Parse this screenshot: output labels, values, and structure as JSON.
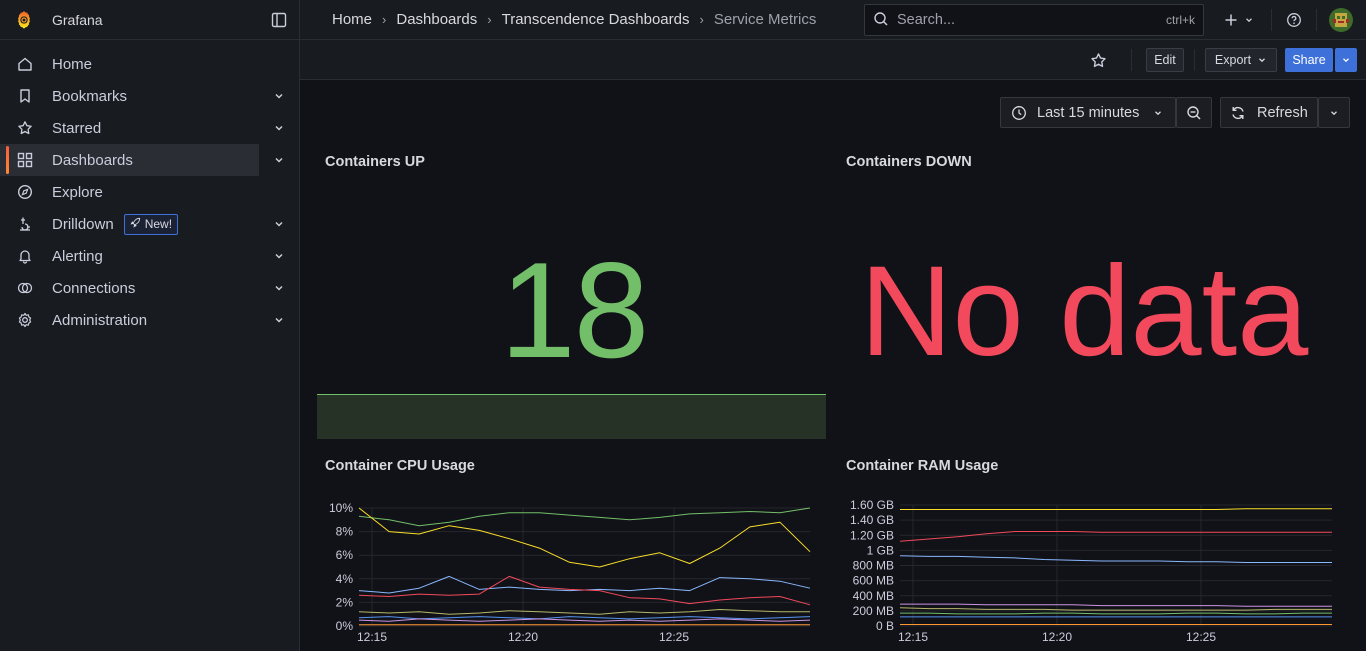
{
  "app": {
    "name": "Grafana"
  },
  "sidebar": {
    "items": [
      {
        "label": "Home",
        "icon": "home-icon",
        "expandable": false
      },
      {
        "label": "Bookmarks",
        "icon": "bookmark-icon",
        "expandable": true
      },
      {
        "label": "Starred",
        "icon": "star-icon",
        "expandable": true
      },
      {
        "label": "Dashboards",
        "icon": "apps-icon",
        "expandable": true,
        "active": true
      },
      {
        "label": "Explore",
        "icon": "compass-icon",
        "expandable": false
      },
      {
        "label": "Drilldown",
        "icon": "drilldown-icon",
        "expandable": true,
        "badge": "New!"
      },
      {
        "label": "Alerting",
        "icon": "bell-icon",
        "expandable": true
      },
      {
        "label": "Connections",
        "icon": "connections-icon",
        "expandable": true
      },
      {
        "label": "Administration",
        "icon": "cog-icon",
        "expandable": true
      }
    ]
  },
  "breadcrumbs": [
    "Home",
    "Dashboards",
    "Transcendence Dashboards",
    "Service Metrics"
  ],
  "search": {
    "placeholder": "Search...",
    "shortcut": "ctrl+k"
  },
  "toolbar": {
    "edit": "Edit",
    "export": "Export",
    "share": "Share"
  },
  "time": {
    "range": "Last 15 minutes",
    "refresh": "Refresh"
  },
  "colors": {
    "accent": "#3d71d9",
    "green": "#73bf69",
    "red": "#f2495c",
    "yellow": "#fade2a",
    "blue": "#8ab8ff"
  },
  "panels": {
    "up": {
      "title": "Containers UP",
      "value": "18"
    },
    "down": {
      "title": "Containers DOWN",
      "value": "No data"
    },
    "cpu": {
      "title": "Container CPU Usage"
    },
    "ram": {
      "title": "Container RAM Usage"
    }
  },
  "chart_data": [
    {
      "type": "line",
      "title": "Container CPU Usage",
      "x_ticks": [
        "12:15",
        "12:20",
        "12:25"
      ],
      "y_ticks": [
        "0%",
        "2%",
        "4%",
        "6%",
        "8%",
        "10%"
      ],
      "ylim": [
        0,
        10
      ],
      "x": [
        0,
        1,
        2,
        3,
        4,
        5,
        6,
        7,
        8,
        9,
        10,
        11,
        12,
        13,
        14,
        15
      ],
      "series": [
        {
          "color": "#73bf69",
          "values": [
            9.3,
            9.0,
            8.5,
            8.8,
            9.3,
            9.6,
            9.6,
            9.4,
            9.2,
            9.0,
            9.2,
            9.5,
            9.6,
            9.7,
            9.6,
            10.0
          ]
        },
        {
          "color": "#fade2a",
          "values": [
            10.0,
            8.0,
            7.8,
            8.5,
            8.1,
            7.4,
            6.6,
            5.4,
            5.0,
            5.7,
            6.2,
            5.3,
            6.6,
            8.4,
            8.8,
            6.3
          ]
        },
        {
          "color": "#8ab8ff",
          "values": [
            3.0,
            2.8,
            3.2,
            4.2,
            3.1,
            3.3,
            3.1,
            3.0,
            3.1,
            3.0,
            3.2,
            3.0,
            4.1,
            4.0,
            3.8,
            3.2
          ]
        },
        {
          "color": "#f2495c",
          "values": [
            2.6,
            2.5,
            2.7,
            2.6,
            2.7,
            4.2,
            3.3,
            3.1,
            3.0,
            2.4,
            2.3,
            1.9,
            2.2,
            2.4,
            2.5,
            1.8
          ]
        },
        {
          "color": "#b7b76b",
          "values": [
            1.2,
            1.1,
            1.2,
            1.0,
            1.1,
            1.3,
            1.2,
            1.1,
            1.0,
            1.2,
            1.1,
            1.2,
            1.4,
            1.3,
            1.2,
            1.2
          ]
        },
        {
          "color": "#5794f2",
          "values": [
            0.7,
            0.8,
            0.6,
            0.7,
            0.8,
            0.7,
            0.6,
            0.8,
            0.7,
            0.6,
            0.7,
            0.8,
            0.7,
            0.6,
            0.7,
            0.8
          ]
        },
        {
          "color": "#ca95e5",
          "values": [
            0.5,
            0.4,
            0.6,
            0.5,
            0.4,
            0.5,
            0.6,
            0.5,
            0.4,
            0.5,
            0.4,
            0.5,
            0.6,
            0.5,
            0.4,
            0.5
          ]
        },
        {
          "color": "#ff9830",
          "values": [
            0.1,
            0.1,
            0.1,
            0.1,
            0.1,
            0.1,
            0.1,
            0.1,
            0.1,
            0.1,
            0.1,
            0.1,
            0.1,
            0.1,
            0.1,
            0.1
          ]
        }
      ]
    },
    {
      "type": "line",
      "title": "Container RAM Usage",
      "x_ticks": [
        "12:15",
        "12:20",
        "12:25"
      ],
      "y_ticks": [
        "0 B",
        "200 MB",
        "400 MB",
        "600 MB",
        "800 MB",
        "1 GB",
        "1.20 GB",
        "1.40 GB",
        "1.60 GB"
      ],
      "ylim": [
        0,
        1.6
      ],
      "y_unit": "GB",
      "x": [
        0,
        1,
        2,
        3,
        4,
        5,
        6,
        7,
        8,
        9,
        10,
        11,
        12,
        13,
        14,
        15
      ],
      "series": [
        {
          "color": "#fade2a",
          "values": [
            1.54,
            1.54,
            1.54,
            1.54,
            1.54,
            1.54,
            1.54,
            1.54,
            1.54,
            1.54,
            1.54,
            1.54,
            1.55,
            1.55,
            1.55,
            1.55
          ]
        },
        {
          "color": "#f2495c",
          "values": [
            1.12,
            1.15,
            1.18,
            1.22,
            1.25,
            1.25,
            1.25,
            1.24,
            1.24,
            1.24,
            1.24,
            1.24,
            1.24,
            1.24,
            1.24,
            1.24
          ]
        },
        {
          "color": "#8ab8ff",
          "values": [
            0.93,
            0.92,
            0.92,
            0.91,
            0.9,
            0.88,
            0.87,
            0.86,
            0.86,
            0.86,
            0.85,
            0.85,
            0.84,
            0.84,
            0.84,
            0.84
          ]
        },
        {
          "color": "#ca95e5",
          "values": [
            0.29,
            0.29,
            0.29,
            0.28,
            0.28,
            0.28,
            0.28,
            0.27,
            0.27,
            0.27,
            0.27,
            0.27,
            0.26,
            0.26,
            0.26,
            0.26
          ]
        },
        {
          "color": "#b7b76b",
          "values": [
            0.24,
            0.23,
            0.23,
            0.22,
            0.22,
            0.22,
            0.21,
            0.21,
            0.21,
            0.21,
            0.21,
            0.21,
            0.21,
            0.22,
            0.22,
            0.22
          ]
        },
        {
          "color": "#73bf69",
          "values": [
            0.17,
            0.17,
            0.16,
            0.16,
            0.16,
            0.17,
            0.17,
            0.16,
            0.16,
            0.16,
            0.17,
            0.17,
            0.16,
            0.16,
            0.17,
            0.17
          ]
        },
        {
          "color": "#5794f2",
          "values": [
            0.12,
            0.12,
            0.12,
            0.12,
            0.12,
            0.12,
            0.12,
            0.12,
            0.12,
            0.12,
            0.12,
            0.12,
            0.12,
            0.12,
            0.12,
            0.12
          ]
        },
        {
          "color": "#ff9830",
          "values": [
            0.02,
            0.02,
            0.02,
            0.02,
            0.02,
            0.02,
            0.02,
            0.02,
            0.02,
            0.02,
            0.02,
            0.02,
            0.02,
            0.02,
            0.02,
            0.02
          ]
        }
      ]
    }
  ]
}
